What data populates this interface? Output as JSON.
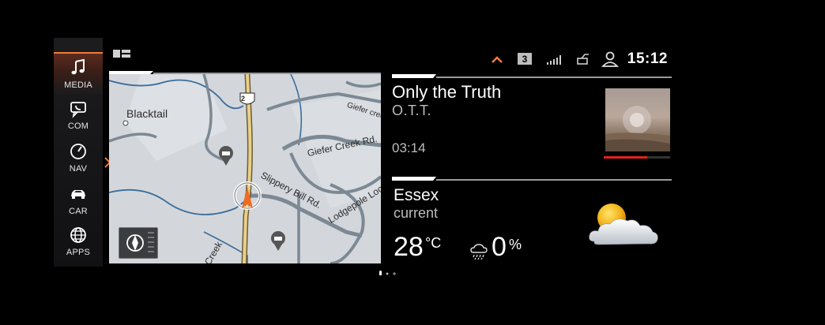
{
  "sidebar": {
    "items": [
      {
        "label": "MEDIA",
        "icon": "music-note-icon",
        "active": true
      },
      {
        "label": "COM",
        "icon": "phone-message-icon",
        "active": false
      },
      {
        "label": "NAV",
        "icon": "navigation-compass-icon",
        "active": false
      },
      {
        "label": "CAR",
        "icon": "car-icon",
        "active": false
      },
      {
        "label": "APPS",
        "icon": "globe-icon",
        "active": false
      }
    ]
  },
  "status": {
    "icons": [
      "chevron-up-icon",
      "signal-bars-icon",
      "phone-sync-icon",
      "user-profile-icon"
    ],
    "badge": "3",
    "time": "15:12",
    "accent_color": "#f07b3a"
  },
  "map": {
    "route_shield": "2",
    "place_label": "Blacktail",
    "road_labels": [
      "Giefer Creek Rd.",
      "Slippery Bill Rd.",
      "Lodgepole Loop",
      "Giefer creek",
      "Creek"
    ]
  },
  "media": {
    "title": "Only the Truth",
    "artist": "O.T.T.",
    "elapsed": "03:14",
    "progress_fraction": 0.65,
    "progress_color": "#e2231a"
  },
  "weather": {
    "city": "Essex",
    "subtitle": "current",
    "temperature": "28",
    "temperature_unit": "°C",
    "precipitation": "0",
    "precipitation_unit": "%",
    "icon": "partly-cloudy-sun-icon"
  }
}
